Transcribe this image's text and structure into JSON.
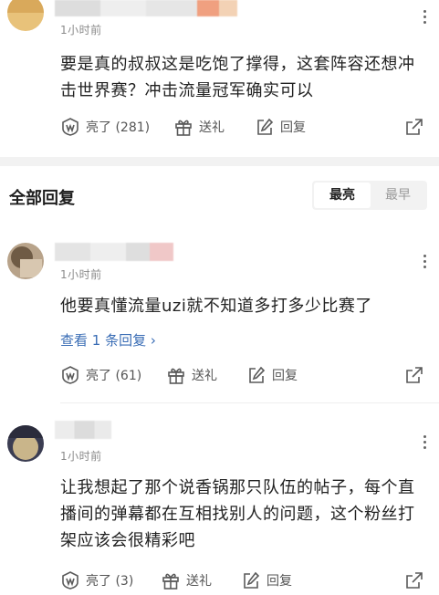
{
  "top_comment": {
    "time": "1小时前",
    "text": "要是真的叔叔这是吃饱了撑得，这套阵容还想冲击世界赛？冲击流量冠军确实可以",
    "like_label": "亮了 (281)",
    "gift_label": "送礼",
    "reply_label": "回复"
  },
  "section": {
    "title": "全部回复",
    "sort_options": [
      "最亮",
      "最早"
    ],
    "active_sort": "最亮"
  },
  "comments": [
    {
      "time": "1小时前",
      "text": "他要真懂流量uzi就不知道多打多少比赛了",
      "view_replies": "查看 1 条回复 ›",
      "like_label": "亮了 (61)",
      "gift_label": "送礼",
      "reply_label": "回复"
    },
    {
      "time": "1小时前",
      "text": "让我想起了那个说香锅那只队伍的帖子，每个直播间的弹幕都在互相找别人的问题，这个粉丝打架应该会很精彩吧",
      "like_label": "亮了 (3)",
      "gift_label": "送礼",
      "reply_label": "回复"
    }
  ],
  "colors": {
    "link": "#3a6db5",
    "icon": "#5a5a5a",
    "divider": "#f2f2f2"
  }
}
